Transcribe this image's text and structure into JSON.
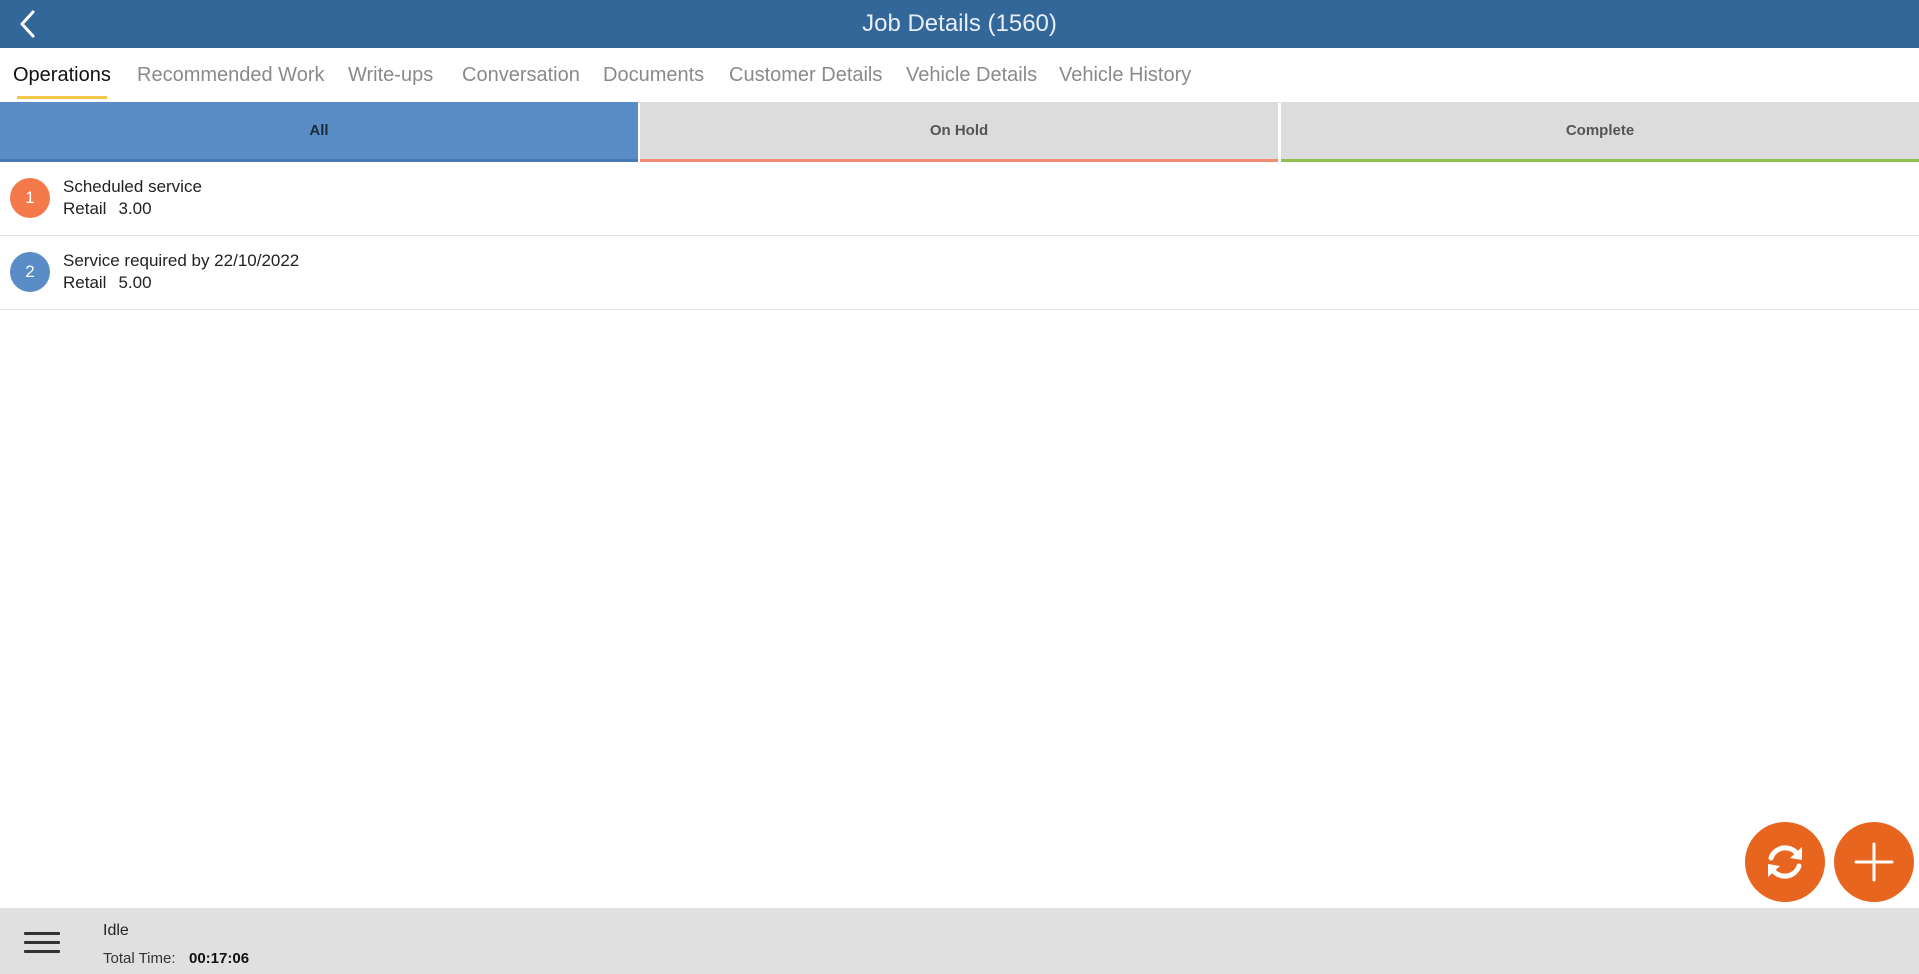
{
  "header": {
    "title": "Job Details (1560)",
    "back_icon": "chevron-left-icon",
    "bar_color": "#336699"
  },
  "tabs": [
    {
      "label": "Operations",
      "active": true
    },
    {
      "label": "Recommended Work",
      "active": false
    },
    {
      "label": "Write-ups",
      "active": false
    },
    {
      "label": "Conversation",
      "active": false
    },
    {
      "label": "Documents",
      "active": false
    },
    {
      "label": "Customer Details",
      "active": false
    },
    {
      "label": "Vehicle Details",
      "active": false
    },
    {
      "label": "Vehicle History",
      "active": false
    }
  ],
  "filters": [
    {
      "label": "All",
      "selected": true,
      "accent": "#4a7ab4"
    },
    {
      "label": "On Hold",
      "selected": false,
      "accent": "#f08c74"
    },
    {
      "label": "Complete",
      "selected": false,
      "accent": "#8cc152"
    }
  ],
  "operations": [
    {
      "number": "1",
      "title": "Scheduled service",
      "type": "Retail",
      "amount": "3.00",
      "badge_color": "#f47a4b"
    },
    {
      "number": "2",
      "title": "Service required by 22/10/2022",
      "type": "Retail",
      "amount": "5.00",
      "badge_color": "#5a8cc6"
    }
  ],
  "actions": {
    "refresh_icon": "refresh-icon",
    "add_icon": "plus-icon",
    "accent": "#e8651f"
  },
  "footer": {
    "menu_icon": "hamburger-menu-icon",
    "status": "Idle",
    "total_time_label": "Total Time:",
    "total_time_value": "00:17:06"
  }
}
